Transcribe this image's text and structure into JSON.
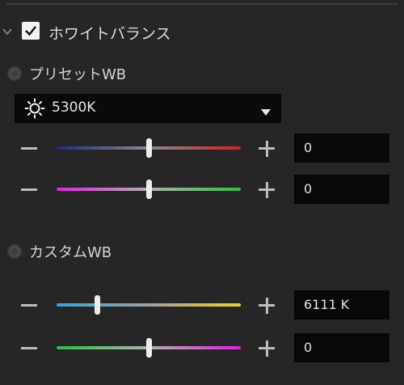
{
  "white_balance": {
    "title": "ホワイトバランス",
    "enabled": true,
    "preset": {
      "label": "プリセットWB",
      "selected": "5300K",
      "sliders": [
        {
          "value_text": "0",
          "level": 0.5,
          "colors": [
            "#1f2a8c",
            "#8a8a8a",
            "#d41f1f"
          ]
        },
        {
          "value_text": "0",
          "level": 0.5,
          "colors": [
            "#e61fe6",
            "#b0b0b0",
            "#26c43a"
          ]
        }
      ]
    },
    "custom": {
      "label": "カスタムWB",
      "sliders": [
        {
          "value_text": "6111 K",
          "level": 0.22,
          "colors": [
            "#2fa6e0",
            "#a0a0a0",
            "#f2d21a"
          ]
        },
        {
          "value_text": "0",
          "level": 0.5,
          "colors": [
            "#26c43a",
            "#b0b0b0",
            "#e61fe6"
          ]
        }
      ]
    }
  }
}
